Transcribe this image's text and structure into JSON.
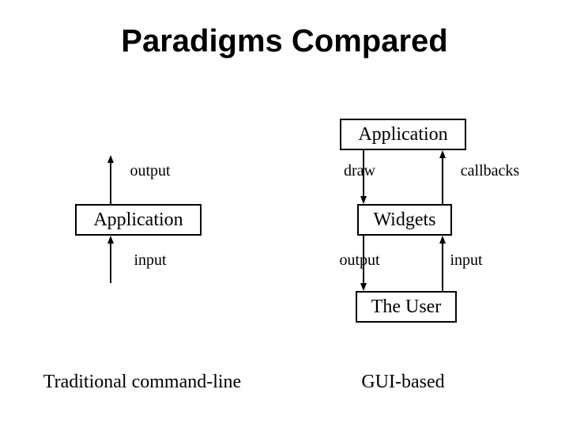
{
  "title": "Paradigms Compared",
  "left": {
    "box_app": "Application",
    "label_output": "output",
    "label_input": "input",
    "caption": "Traditional command-line"
  },
  "right": {
    "box_app": "Application",
    "box_widgets": "Widgets",
    "box_user": "The User",
    "label_draw": "draw",
    "label_callbacks": "callbacks",
    "label_output": "output",
    "label_input": "input",
    "caption": "GUI-based"
  }
}
